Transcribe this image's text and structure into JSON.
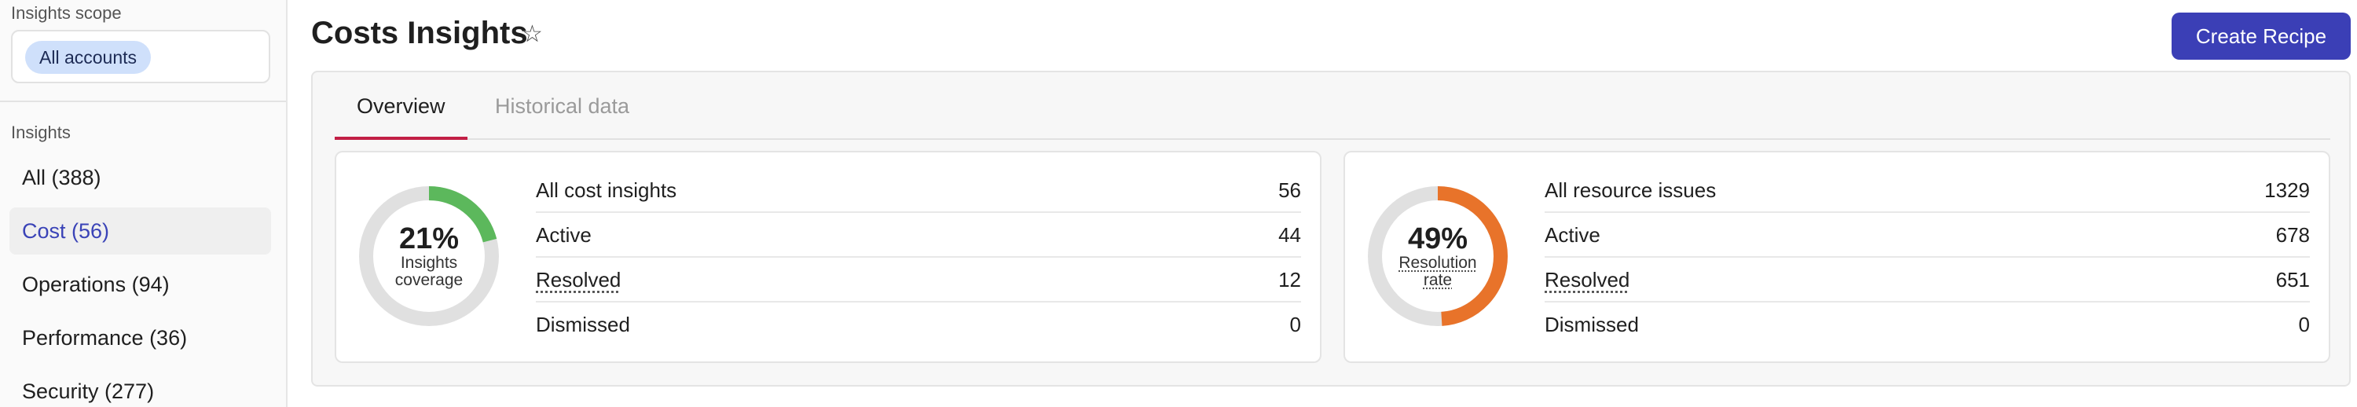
{
  "sidebar": {
    "scope_label": "Insights scope",
    "scope_chip": "All accounts",
    "insights_label": "Insights",
    "items": [
      {
        "label": "All (388)"
      },
      {
        "label": "Cost (56)"
      },
      {
        "label": "Operations (94)"
      },
      {
        "label": "Performance (36)"
      },
      {
        "label": "Security (277)"
      }
    ],
    "active_item": "Cost (56)"
  },
  "header": {
    "title": "Costs Insights",
    "favorite_icon": "star-outline-icon",
    "create_button": "Create Recipe"
  },
  "tabs": [
    {
      "label": "Overview",
      "active": true
    },
    {
      "label": "Historical data",
      "active": false
    }
  ],
  "cards": {
    "coverage": {
      "percent_label": "21%",
      "percent_value": 21,
      "caption_line1": "Insights",
      "caption_line2": "coverage",
      "color": "#5cb85c",
      "rows": [
        {
          "label": "All cost insights",
          "value": "56"
        },
        {
          "label": "Active",
          "value": "44"
        },
        {
          "label": "Resolved",
          "value": "12"
        },
        {
          "label": "Dismissed",
          "value": "0"
        }
      ]
    },
    "resolution": {
      "percent_label": "49%",
      "percent_value": 49,
      "caption_line1": "Resolution",
      "caption_line2": "rate",
      "color": "#e8732a",
      "rows": [
        {
          "label": "All resource issues",
          "value": "1329"
        },
        {
          "label": "Active",
          "value": "678"
        },
        {
          "label": "Resolved",
          "value": "651"
        },
        {
          "label": "Dismissed",
          "value": "0"
        }
      ]
    }
  },
  "colors": {
    "accent": "#3b3fb6",
    "tab_underline": "#c21f45",
    "chip_bg": "#cfe0fb",
    "donut_track": "#e0e0e0"
  }
}
